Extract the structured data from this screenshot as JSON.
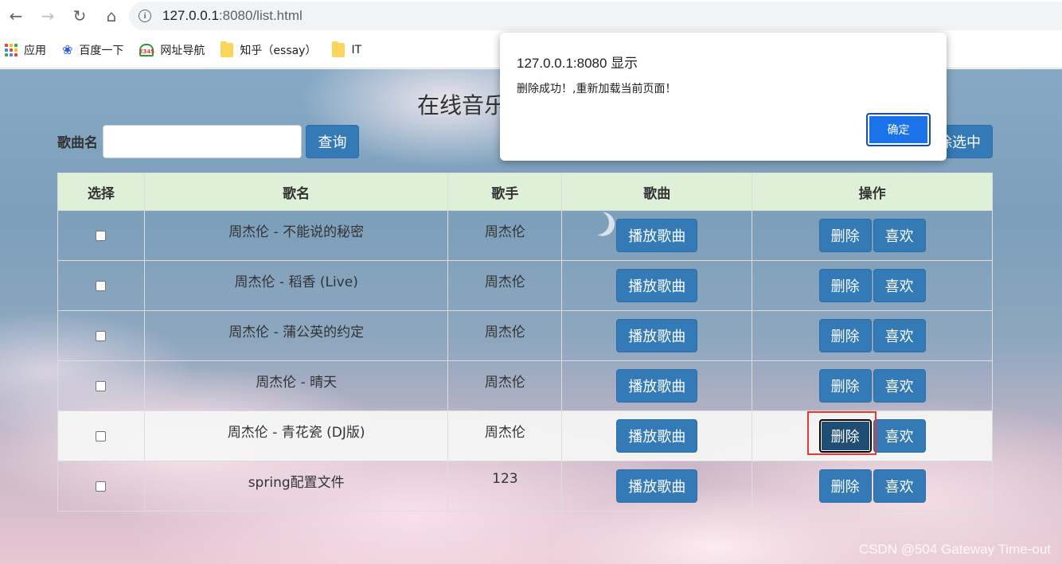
{
  "browser": {
    "url_host": "127.0.0.1",
    "url_rest": ":8080/list.html"
  },
  "bookmarks": [
    {
      "label": "应用",
      "icon": "apps-grid-icon"
    },
    {
      "label": "百度一下",
      "icon": "baidu-paw-icon"
    },
    {
      "label": "网址导航",
      "icon": "2345-icon"
    },
    {
      "label": "知乎（essay）",
      "icon": "folder-icon"
    },
    {
      "label": "IT",
      "icon": "folder-icon"
    }
  ],
  "page": {
    "title": "在线音乐",
    "search_label": "歌曲名",
    "search_value": "",
    "query_button": "查询",
    "bulk_delete_button": "删除选中"
  },
  "table": {
    "headers": [
      "选择",
      "歌名",
      "歌手",
      "歌曲",
      "操作"
    ],
    "play_label": "播放歌曲",
    "delete_label": "删除",
    "like_label": "喜欢",
    "rows": [
      {
        "title": "周杰伦 - 不能说的秘密",
        "singer": "周杰伦"
      },
      {
        "title": "周杰伦 - 稻香 (Live)",
        "singer": "周杰伦"
      },
      {
        "title": "周杰伦 - 蒲公英的约定",
        "singer": "周杰伦"
      },
      {
        "title": "周杰伦 - 晴天",
        "singer": "周杰伦"
      },
      {
        "title": "周杰伦 - 青花瓷 (DJ版)",
        "singer": "周杰伦"
      },
      {
        "title": "spring配置文件",
        "singer": "123"
      }
    ]
  },
  "dialog": {
    "title": "127.0.0.1:8080 显示",
    "message": "删除成功！,重新加载当前页面！",
    "ok_label": "确定"
  },
  "watermark": "CSDN @504 Gateway Time-out",
  "colors": {
    "primary_button": "#337ab7",
    "header_row": "#dff0d8",
    "dialog_ok": "#1a73e8",
    "highlight": "#e53935"
  }
}
